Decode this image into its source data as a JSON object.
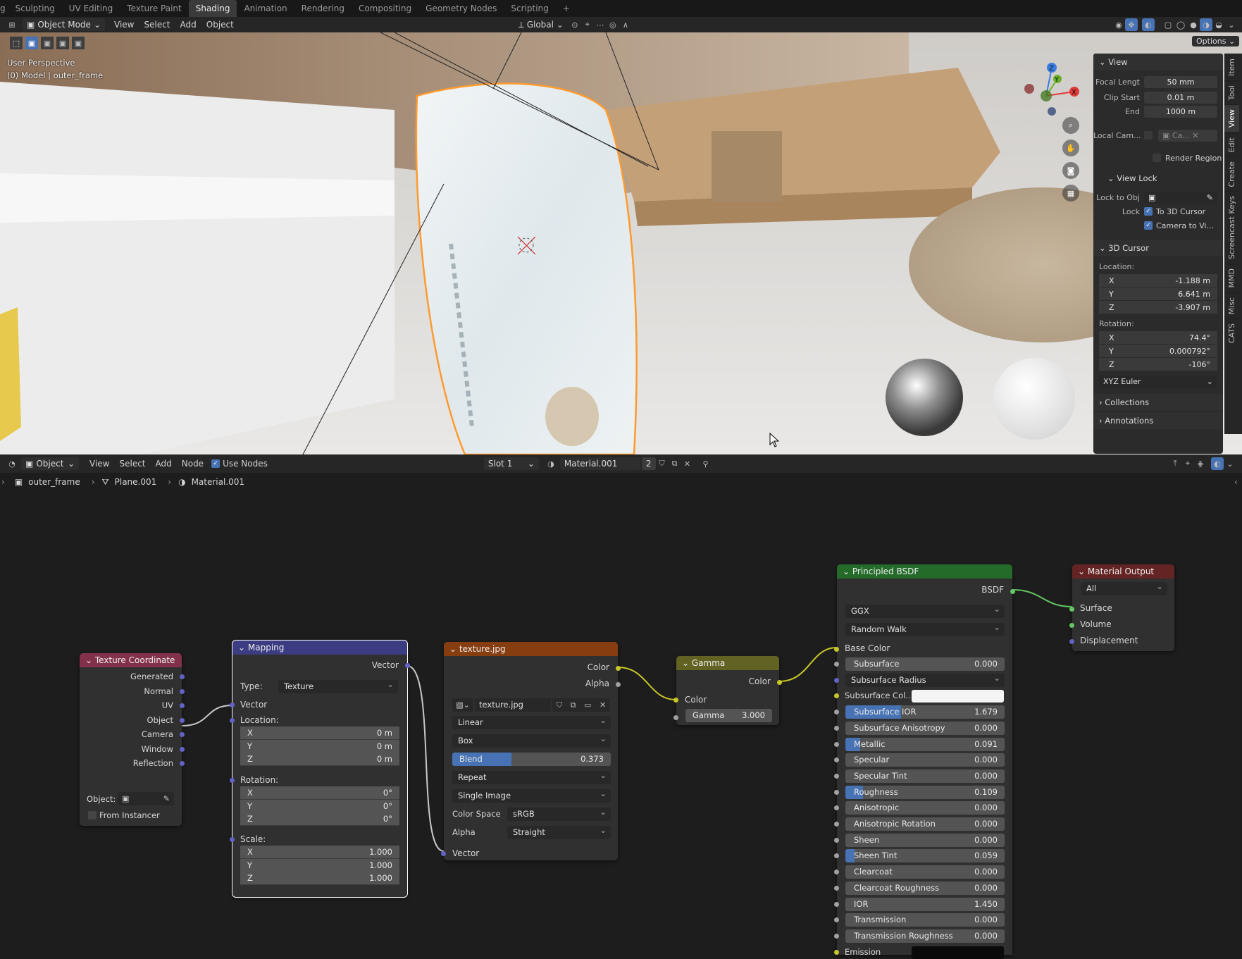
{
  "workspaces": [
    "g",
    "Sculpting",
    "UV Editing",
    "Texture Paint",
    "Shading",
    "Animation",
    "Rendering",
    "Compositing",
    "Geometry Nodes",
    "Scripting",
    "+"
  ],
  "active_workspace": "Shading",
  "viewport_header": {
    "mode": "Object Mode",
    "menus": [
      "View",
      "Select",
      "Add",
      "Object"
    ],
    "transform": "Global",
    "options": "Options"
  },
  "viewport_overlay": {
    "perspective": "User Perspective",
    "object": "(0) Model | outer_frame"
  },
  "n_panel": {
    "view_title": "View",
    "focal_length_label": "Focal Lengt",
    "focal_length": "50 mm",
    "clip_start_label": "Clip Start",
    "clip_start": "0.01 m",
    "end_label": "End",
    "end": "1000 m",
    "local_cam_label": "Local Cam...",
    "local_cam_value": "Ca...",
    "render_region": "Render Region",
    "view_lock_title": "View Lock",
    "lock_to_obj": "Lock to Obj",
    "lock_label": "Lock",
    "to_3d_cursor": "To 3D Cursor",
    "camera_to_view": "Camera to Vi...",
    "cursor_title": "3D Cursor",
    "location_label": "Location:",
    "loc": [
      {
        "axis": "X",
        "value": "-1.188 m"
      },
      {
        "axis": "Y",
        "value": "6.641 m"
      },
      {
        "axis": "Z",
        "value": "-3.907 m"
      }
    ],
    "rotation_label": "Rotation:",
    "rot": [
      {
        "axis": "X",
        "value": "74.4°"
      },
      {
        "axis": "Y",
        "value": "0.000792°"
      },
      {
        "axis": "Z",
        "value": "-106°"
      }
    ],
    "rotation_mode": "XYZ Euler",
    "collections": "Collections",
    "annotations": "Annotations"
  },
  "side_tabs": [
    "Item",
    "Tool",
    "View",
    "Edit",
    "Create",
    "Screencast Keys",
    "MMD",
    "Misc",
    "CATS"
  ],
  "node_header": {
    "type": "Object",
    "menus": [
      "View",
      "Select",
      "Add",
      "Node"
    ],
    "use_nodes": "Use Nodes",
    "slot": "Slot 1",
    "material": "Material.001",
    "users": "2"
  },
  "breadcrumbs": [
    "outer_frame",
    "Plane.001",
    "Material.001"
  ],
  "tex_coord": {
    "title": "Texture Coordinate",
    "outputs": [
      "Generated",
      "Normal",
      "UV",
      "Object",
      "Camera",
      "Window",
      "Reflection"
    ],
    "object_label": "Object:",
    "from_instancer": "From Instancer"
  },
  "mapping": {
    "title": "Mapping",
    "out": "Vector",
    "type_label": "Type:",
    "type": "Texture",
    "in_vector": "Vector",
    "location_label": "Location:",
    "location": [
      [
        "X",
        "0 m"
      ],
      [
        "Y",
        "0 m"
      ],
      [
        "Z",
        "0 m"
      ]
    ],
    "rotation_label": "Rotation:",
    "rotation": [
      [
        "X",
        "0°"
      ],
      [
        "Y",
        "0°"
      ],
      [
        "Z",
        "0°"
      ]
    ],
    "scale_label": "Scale:",
    "scale": [
      [
        "X",
        "1.000"
      ],
      [
        "Y",
        "1.000"
      ],
      [
        "Z",
        "1.000"
      ]
    ]
  },
  "image_tex": {
    "title": "texture.jpg",
    "out_color": "Color",
    "out_alpha": "Alpha",
    "image": "texture.jpg",
    "interpolation": "Linear",
    "projection": "Box",
    "blend_label": "Blend",
    "blend": "0.373",
    "blend_fraction": 0.373,
    "extension": "Repeat",
    "source": "Single Image",
    "color_space_label": "Color Space",
    "color_space": "sRGB",
    "alpha_label": "Alpha",
    "alpha": "Straight",
    "in_vector": "Vector"
  },
  "gamma": {
    "title": "Gamma",
    "out": "Color",
    "in": "Color",
    "gamma_label": "Gamma",
    "gamma": "3.000"
  },
  "bsdf": {
    "title": "Principled BSDF",
    "out": "BSDF",
    "distribution": "GGX",
    "subsurface_method": "Random Walk",
    "base_color": "Base Color",
    "rows": [
      {
        "label": "Subsurface",
        "value": "0.000",
        "fill": 0
      },
      {
        "label": "Subsurface Radius",
        "value": "",
        "fill": 0,
        "select": true
      },
      {
        "label": "Subsurface Col...",
        "value": "",
        "fill": 0,
        "color": true
      },
      {
        "label": "Subsurface IOR",
        "value": "1.679",
        "fill": 0.35
      },
      {
        "label": "Subsurface Anisotropy",
        "value": "0.000",
        "fill": 0
      },
      {
        "label": "Metallic",
        "value": "0.091",
        "fill": 0.091
      },
      {
        "label": "Specular",
        "value": "0.000",
        "fill": 0
      },
      {
        "label": "Specular Tint",
        "value": "0.000",
        "fill": 0
      },
      {
        "label": "Roughness",
        "value": "0.109",
        "fill": 0.109
      },
      {
        "label": "Anisotropic",
        "value": "0.000",
        "fill": 0
      },
      {
        "label": "Anisotropic Rotation",
        "value": "0.000",
        "fill": 0
      },
      {
        "label": "Sheen",
        "value": "0.000",
        "fill": 0
      },
      {
        "label": "Sheen Tint",
        "value": "0.059",
        "fill": 0.059
      },
      {
        "label": "Clearcoat",
        "value": "0.000",
        "fill": 0
      },
      {
        "label": "Clearcoat Roughness",
        "value": "0.000",
        "fill": 0
      },
      {
        "label": "IOR",
        "value": "1.450",
        "fill": 0
      },
      {
        "label": "Transmission",
        "value": "0.000",
        "fill": 0
      },
      {
        "label": "Transmission Roughness",
        "value": "0.000",
        "fill": 0
      },
      {
        "label": "Emission",
        "value": "",
        "fill": 0,
        "color": true,
        "dark": true
      }
    ]
  },
  "output": {
    "title": "Material Output",
    "target": "All",
    "inputs": [
      "Surface",
      "Volume",
      "Displacement"
    ]
  },
  "colors": {
    "texcoord_header": "#83314a",
    "mapping_header": "#3c3c83",
    "image_header": "#863d10",
    "gamma_header": "#626223",
    "bsdf_header": "#246b2a",
    "output_header": "#642424",
    "vector_socket": "#6363c7",
    "color_socket": "#c7c729",
    "shader_socket": "#63c763",
    "float_socket": "#a1a1a1",
    "selected_outline": "#ffa033"
  }
}
